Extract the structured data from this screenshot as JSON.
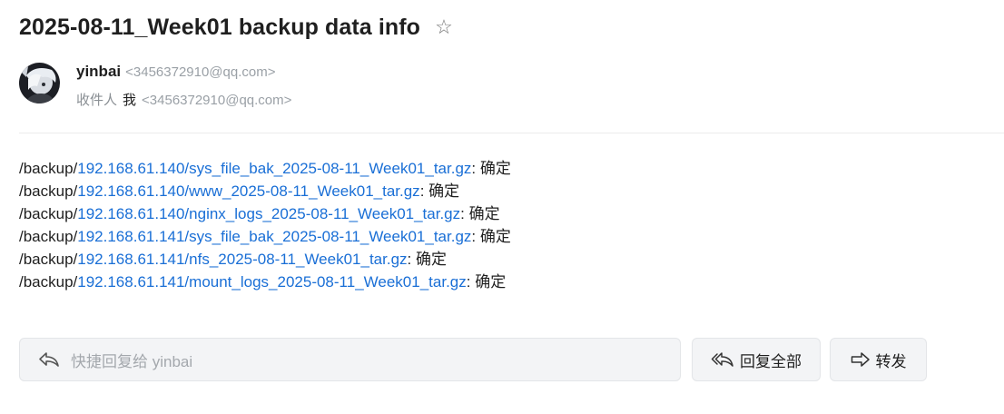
{
  "email": {
    "subject": "2025-08-11_Week01 backup data info",
    "star_icon": "star-outline-icon",
    "sender": {
      "name": "yinbai",
      "email": "<3456372910@qq.com>",
      "avatar": "avatar-anime-character"
    },
    "recipients": {
      "label": "收件人",
      "name": "我",
      "email": "<3456372910@qq.com>"
    },
    "body_lines": [
      {
        "prefix": "/backup/",
        "link": "192.168.61.140/sys_file_bak_2025-08-11_Week01_tar.gz",
        "suffix": ": 确定"
      },
      {
        "prefix": "/backup/",
        "link": "192.168.61.140/www_2025-08-11_Week01_tar.gz",
        "suffix": ": 确定"
      },
      {
        "prefix": "/backup/",
        "link": "192.168.61.140/nginx_logs_2025-08-11_Week01_tar.gz",
        "suffix": ": 确定"
      },
      {
        "prefix": "/backup/",
        "link": "192.168.61.141/sys_file_bak_2025-08-11_Week01_tar.gz",
        "suffix": ": 确定"
      },
      {
        "prefix": "/backup/",
        "link": "192.168.61.141/nfs_2025-08-11_Week01_tar.gz",
        "suffix": ": 确定"
      },
      {
        "prefix": "/backup/",
        "link": "192.168.61.141/mount_logs_2025-08-11_Week01_tar.gz",
        "suffix": ": 确定"
      }
    ]
  },
  "actions": {
    "quick_reply_placeholder": "快捷回复给 yinbai",
    "reply_all_label": "回复全部",
    "forward_label": "转发"
  },
  "colors": {
    "link": "#1a6fd6",
    "button_bg": "#f3f4f6",
    "muted_text": "#9aa0a6"
  }
}
